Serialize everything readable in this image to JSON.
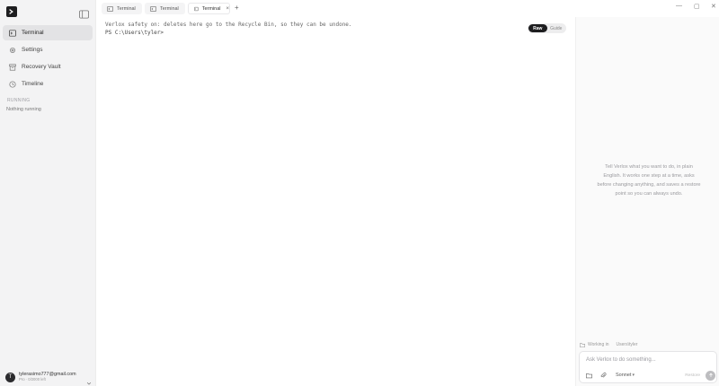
{
  "sidebar": {
    "items": [
      {
        "label": "Terminal",
        "icon": "terminal-icon",
        "active": true
      },
      {
        "label": "Settings",
        "icon": "gear-icon"
      },
      {
        "label": "Recovery Vault",
        "icon": "archive-icon"
      },
      {
        "label": "Timeline",
        "icon": "clock-icon"
      }
    ],
    "section_label": "RUNNING",
    "running_empty": "Nothing running",
    "user": {
      "avatar_letter": "T",
      "email": "tylerasimo777@gmail.com",
      "plan": "Pro · 0/2000 left"
    }
  },
  "tabs": [
    {
      "label": "Terminal"
    },
    {
      "label": "Terminal"
    },
    {
      "label": "Terminal",
      "active": true,
      "close": "×"
    }
  ],
  "tab_add": "+",
  "window_controls": {
    "minimize": "—",
    "maximize": "▢",
    "close": "✕"
  },
  "terminal": {
    "lines": [
      "Verlox safety on: deletes here go to the Recycle Bin, so they can be undone.",
      "PS C:\\Users\\tyler>"
    ]
  },
  "mode_toggle": {
    "options": [
      "Raw",
      "Guide"
    ],
    "selected": "Raw"
  },
  "assistant": {
    "hint": "Tell Verlox what you want to do, in plain English. It works one step at a time, asks before changing anything, and saves a restore point so you can always undo.",
    "working_label": "Working in",
    "working_path": "Users\\tyler",
    "composer": {
      "placeholder": "Ask Verlox to do something...",
      "model": "Sonnet",
      "restore": "Restore"
    }
  },
  "colors": {
    "accent": "#1d1d1f",
    "sidebar_bg": "#f3f3f4",
    "active_item": "#e3e3e5"
  }
}
